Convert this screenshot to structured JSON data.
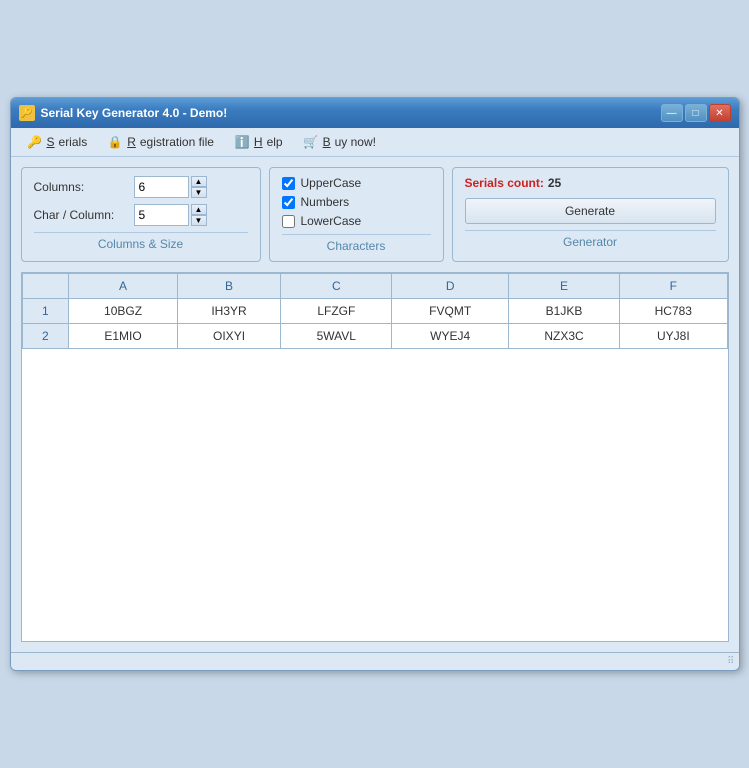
{
  "window": {
    "title": "Serial Key Generator 4.0 - Demo!",
    "controls": {
      "minimize": "—",
      "maximize": "□",
      "close": "✕"
    }
  },
  "menu": {
    "items": [
      {
        "id": "serials",
        "label": "Serials",
        "icon": "key"
      },
      {
        "id": "registration",
        "label": "Registration file",
        "icon": "lock"
      },
      {
        "id": "help",
        "label": "Help",
        "icon": "info"
      },
      {
        "id": "buynow",
        "label": "Buy now!",
        "icon": "cart"
      }
    ]
  },
  "columns_panel": {
    "title": "Columns & Size",
    "columns_label": "Columns:",
    "columns_value": "6",
    "char_column_label": "Char / Column:",
    "char_column_value": "5"
  },
  "characters_panel": {
    "title": "Characters",
    "options": [
      {
        "id": "uppercase",
        "label": "UpperCase",
        "checked": true
      },
      {
        "id": "numbers",
        "label": "Numbers",
        "checked": true
      },
      {
        "id": "lowercase",
        "label": "LowerCase",
        "checked": false
      }
    ]
  },
  "generator_panel": {
    "title": "Generator",
    "serials_count_label": "Serials count:",
    "serials_count_value": "25",
    "generate_button": "Generate"
  },
  "table": {
    "headers": [
      "",
      "A",
      "B",
      "C",
      "D",
      "E",
      "F"
    ],
    "rows": [
      {
        "num": "1",
        "cells": [
          "10BGZ",
          "IH3YR",
          "LFZGF",
          "FVQMT",
          "B1JKB",
          "HC783"
        ]
      },
      {
        "num": "2",
        "cells": [
          "E1MIO",
          "OIXYI",
          "5WAVL",
          "WYEJ4",
          "NZX3C",
          "UYJ8I"
        ]
      }
    ]
  },
  "statusbar": {
    "resize_grip": "⠿"
  }
}
